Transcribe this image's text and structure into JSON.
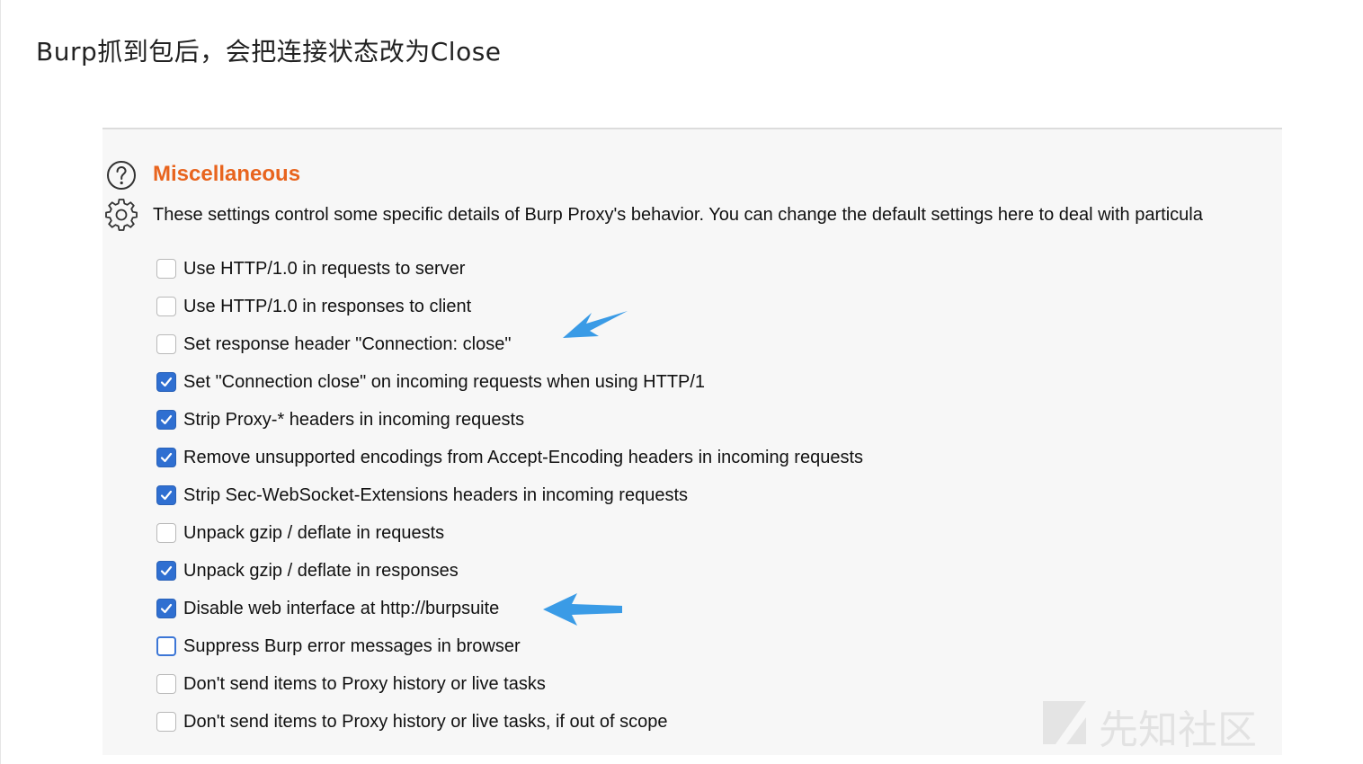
{
  "caption": "Burp抓到包后，会把连接状态改为Close",
  "section": {
    "title": "Miscellaneous",
    "description": "These settings control some specific details of Burp Proxy's behavior. You can change the default settings here to deal with particula",
    "help_icon": "question-circle-icon",
    "settings_icon": "gear-icon"
  },
  "options": [
    {
      "label": "Use HTTP/1.0 in requests to server",
      "checked": false
    },
    {
      "label": "Use HTTP/1.0 in responses to client",
      "checked": false
    },
    {
      "label": "Set response header \"Connection: close\"",
      "checked": false
    },
    {
      "label": "Set \"Connection close\" on incoming requests when using HTTP/1",
      "checked": true
    },
    {
      "label": "Strip Proxy-* headers in incoming requests",
      "checked": true
    },
    {
      "label": "Remove unsupported encodings from Accept-Encoding headers in incoming requests",
      "checked": true
    },
    {
      "label": "Strip Sec-WebSocket-Extensions headers in incoming requests",
      "checked": true
    },
    {
      "label": "Unpack gzip / deflate in requests",
      "checked": false
    },
    {
      "label": "Unpack gzip / deflate in responses",
      "checked": true
    },
    {
      "label": "Disable web interface at http://burpsuite",
      "checked": true
    },
    {
      "label": "Suppress Burp error messages in browser",
      "checked": false,
      "focused": true
    },
    {
      "label": "Don't send items to Proxy history or live tasks",
      "checked": false
    },
    {
      "label": "Don't send items to Proxy history or live tasks, if out of scope",
      "checked": false
    }
  ],
  "colors": {
    "accent_title": "#e8641e",
    "checkbox_checked": "#2f6fd1",
    "annotation_arrow": "#3a9be6"
  },
  "watermark": {
    "text": "先知社区"
  }
}
